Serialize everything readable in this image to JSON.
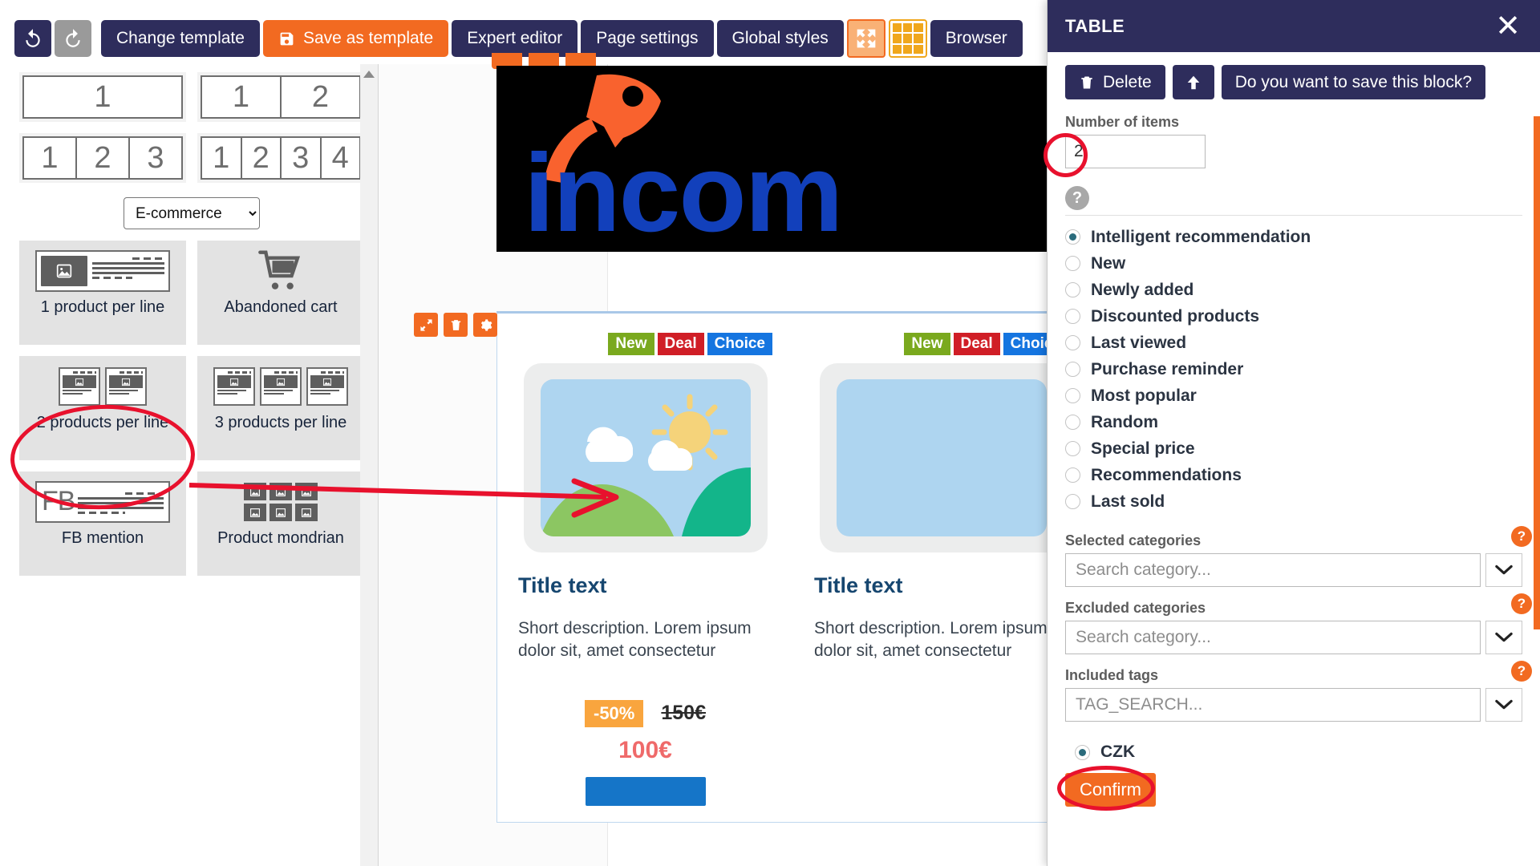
{
  "toolbar": {
    "undo_icon": "undo-arrow-icon",
    "redo_icon": "redo-arrow-icon",
    "change_template": "Change template",
    "save_as_template": "Save as template",
    "save_icon": "floppy-disk-icon",
    "expert_editor": "Expert editor",
    "page_settings": "Page settings",
    "global_styles": "Global styles",
    "expand_icon": "expand-arrows-icon",
    "grid_icon": "grid-icon",
    "browser": "Browser"
  },
  "sidebar": {
    "layouts": [
      {
        "name": "1-column",
        "cells": [
          "1"
        ]
      },
      {
        "name": "2-column",
        "cells": [
          "1",
          "2"
        ]
      },
      {
        "name": "3-column",
        "cells": [
          "1",
          "2",
          "3"
        ]
      },
      {
        "name": "4-column",
        "cells": [
          "1",
          "2",
          "3",
          "4"
        ]
      }
    ],
    "category_select": {
      "value": "E-commerce",
      "options": [
        "E-commerce"
      ]
    },
    "templates": [
      {
        "label": "1 product per line",
        "thumb": "one-product-thumb"
      },
      {
        "label": "Abandoned cart",
        "thumb": "shopping-cart-icon"
      },
      {
        "label": "2 products per line",
        "thumb": "two-products-thumb",
        "highlighted": true
      },
      {
        "label": "3 products per line",
        "thumb": "three-products-thumb"
      },
      {
        "label": "FB mention",
        "thumb": "fb-mention-thumb",
        "fb_text": "FB"
      },
      {
        "label": "Product mondrian",
        "thumb": "mondrian-thumb"
      }
    ]
  },
  "canvas": {
    "logo_text": "incom",
    "logo_icon": "rocket-icon",
    "block_toolbar": [
      {
        "name": "move-block",
        "icon": "move-arrows-icon"
      },
      {
        "name": "delete-block",
        "icon": "trash-icon"
      },
      {
        "name": "block-settings",
        "icon": "gear-icon"
      }
    ],
    "products": [
      {
        "badges": [
          {
            "label": "New",
            "color": "#7aa91e"
          },
          {
            "label": "Deal",
            "color": "#d01e26"
          },
          {
            "label": "Choice",
            "color": "#1575e0"
          }
        ],
        "title": "Title text",
        "description": "Short description. Lorem ipsum dolor sit, amet consectetur",
        "discount": "-50%",
        "old_price": "150€",
        "new_price": "100€",
        "image_alt": "landscape-placeholder-image"
      },
      {
        "title_partial": "Titl",
        "description_partial": "Shor amet"
      }
    ]
  },
  "panel": {
    "title": "TABLE",
    "close_icon": "close-icon",
    "actions": {
      "delete": "Delete",
      "delete_icon": "trash-icon",
      "move_up_icon": "arrow-up-icon",
      "save_block": "Do you want to save this block?"
    },
    "number_of_items": {
      "label": "Number of items",
      "value": "2"
    },
    "help_icon": "question-circle-icon",
    "selection_mode": {
      "selected": "Intelligent recommendation",
      "options": [
        "Intelligent recommendation",
        "New",
        "Newly added",
        "Discounted products",
        "Last viewed",
        "Purchase reminder",
        "Most popular",
        "Random",
        "Special price",
        "Recommendations",
        "Last sold"
      ]
    },
    "fields": [
      {
        "label": "Selected categories",
        "placeholder": "Search category...",
        "value": "",
        "help": "?"
      },
      {
        "label": "Excluded categories",
        "placeholder": "Search category...",
        "value": "",
        "help": "?"
      },
      {
        "label": "Included tags",
        "placeholder": "TAG_SEARCH...",
        "value": "",
        "help": "?"
      }
    ],
    "currency": {
      "label": "CZK",
      "selected": true
    },
    "confirm": "Confirm"
  },
  "colors": {
    "navy": "#2e2d5c",
    "orange": "#f26a21",
    "annotation_red": "#e8112d",
    "accent_teal": "#2a6b7c"
  }
}
